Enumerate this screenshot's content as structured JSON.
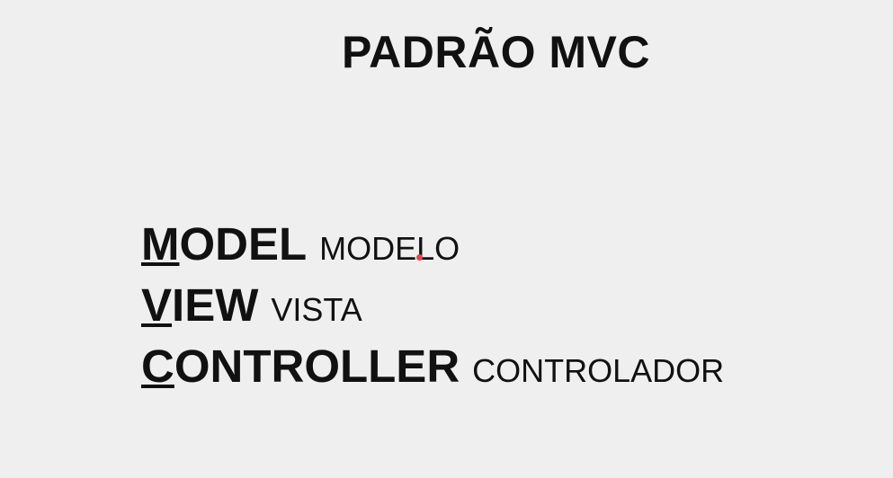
{
  "slide": {
    "title": "PADRÃO MVC",
    "terms": [
      {
        "initial": "M",
        "rest": "ODEL",
        "translation": "MODELO"
      },
      {
        "initial": "V",
        "rest": "IEW",
        "translation": "VISTA"
      },
      {
        "initial": "C",
        "rest": "ONTROLLER",
        "translation": "CONTROLADOR"
      }
    ],
    "cursor_color": "#e0474f"
  }
}
